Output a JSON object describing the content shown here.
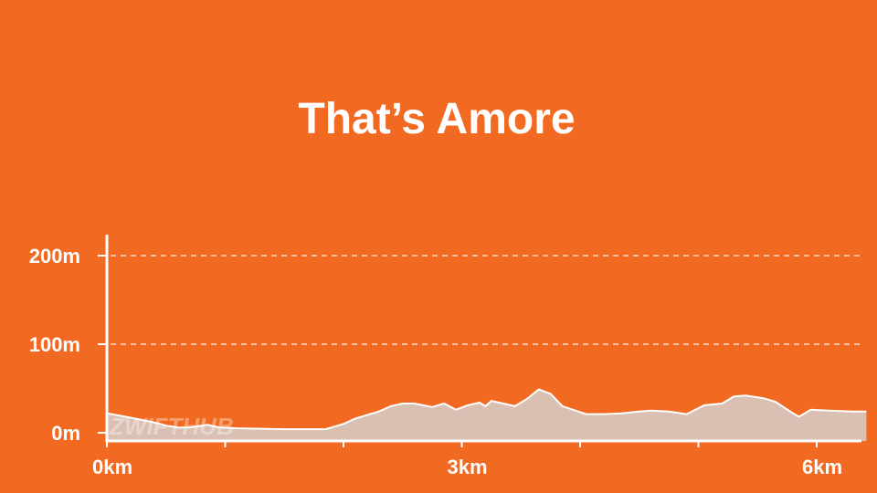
{
  "chart_data": {
    "type": "area",
    "title": "That’s Amore",
    "xlabel": "",
    "ylabel": "",
    "x_unit": "km",
    "y_unit": "m",
    "xlim": [
      0,
      6.45
    ],
    "ylim": [
      -10,
      232
    ],
    "x_ticks": [
      {
        "value": 0,
        "label": "0km"
      },
      {
        "value": 1,
        "label": ""
      },
      {
        "value": 2,
        "label": ""
      },
      {
        "value": 3,
        "label": "3km"
      },
      {
        "value": 4,
        "label": ""
      },
      {
        "value": 5,
        "label": ""
      },
      {
        "value": 6,
        "label": "6km"
      }
    ],
    "y_ticks": [
      {
        "value": 0,
        "label": "0m"
      },
      {
        "value": 100,
        "label": "100m"
      },
      {
        "value": 200,
        "label": "200m"
      }
    ],
    "grid": "horizontal dashed",
    "colors": {
      "background": "#f26a22",
      "fill": "#d9c0b2",
      "line": "#ffffff",
      "grid": "#ffffff",
      "axis": "#ffffff"
    },
    "watermark": "ZWIFTHUB",
    "x": [
      0,
      0.2,
      0.35,
      0.45,
      0.5,
      0.6,
      0.7,
      0.85,
      0.95,
      1.1,
      1.5,
      1.85,
      2.0,
      2.1,
      2.3,
      2.4,
      2.5,
      2.6,
      2.75,
      2.85,
      2.95,
      3.05,
      3.15,
      3.2,
      3.25,
      3.35,
      3.45,
      3.55,
      3.65,
      3.75,
      3.85,
      4.05,
      4.2,
      4.35,
      4.5,
      4.6,
      4.75,
      4.9,
      5.05,
      5.2,
      5.3,
      5.4,
      5.55,
      5.65,
      5.8,
      5.85,
      5.95,
      6.1,
      6.3,
      6.42
    ],
    "values": [
      22,
      17,
      13,
      10,
      8,
      6,
      6,
      9,
      6,
      5,
      4,
      4,
      10,
      16,
      24,
      30,
      33,
      33,
      29,
      33,
      26,
      31,
      34,
      30,
      36,
      33,
      30,
      38,
      49,
      44,
      30,
      21,
      21,
      22,
      24,
      25,
      24,
      21,
      31,
      33,
      41,
      42,
      39,
      35,
      22,
      18,
      26,
      25,
      24,
      24
    ]
  }
}
